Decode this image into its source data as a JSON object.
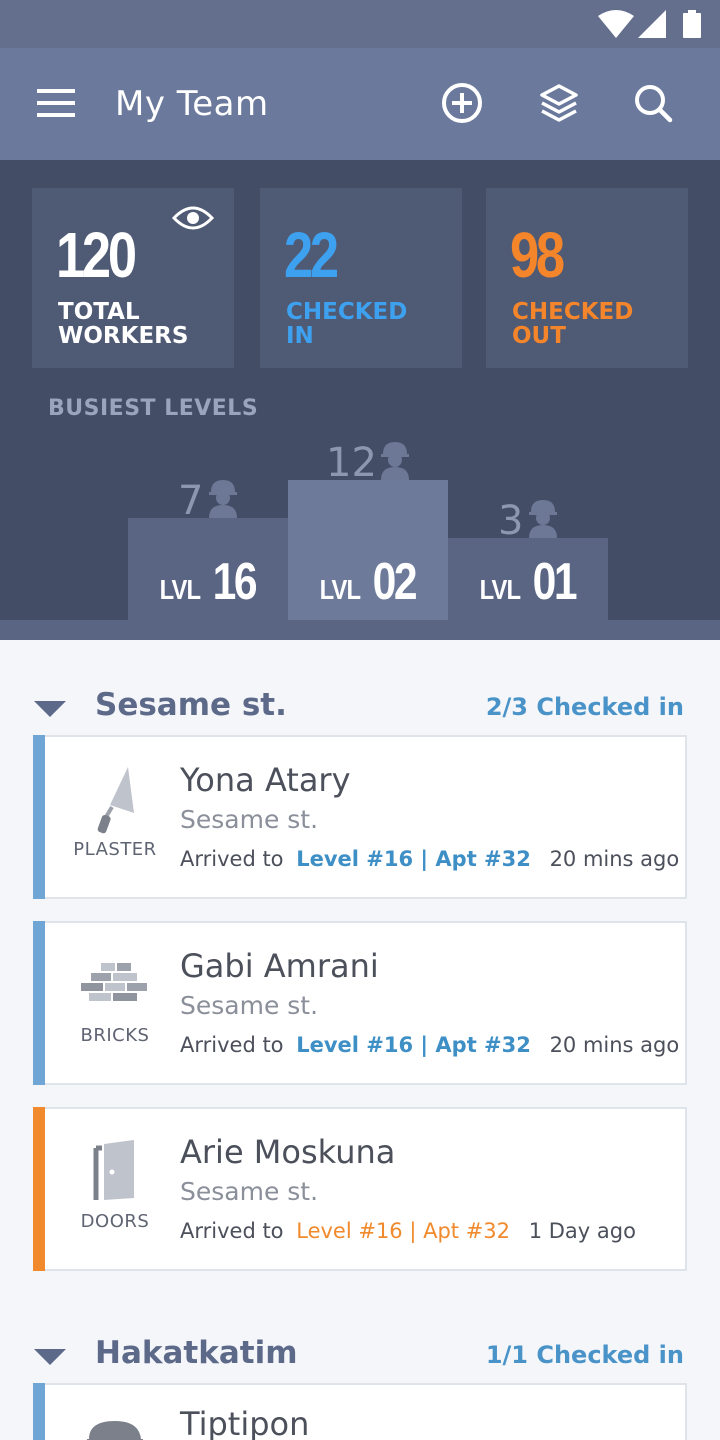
{
  "app": {
    "title": "My Team"
  },
  "stats": {
    "total": {
      "value": "120",
      "label": "TOTAL WORKERS",
      "color": "#ffffff"
    },
    "checked_in": {
      "value": "22",
      "label": "CHECKED IN",
      "color": "#3ea1f0"
    },
    "checked_out": {
      "value": "98",
      "label": "CHECKED OUT",
      "color": "#f5852a"
    }
  },
  "busiest": {
    "title": "BUSIEST LEVELS",
    "levels": [
      {
        "prefix": "LVL",
        "level": "16",
        "count": "7"
      },
      {
        "prefix": "LVL",
        "level": "02",
        "count": "12"
      },
      {
        "prefix": "LVL",
        "level": "01",
        "count": "3"
      }
    ]
  },
  "sections": [
    {
      "name": "Sesame st.",
      "count": "2/3 Checked in",
      "workers": [
        {
          "name": "Yona Atary",
          "site": "Sesame st.",
          "trade": "PLASTER",
          "trade_icon": "trowel-icon",
          "arrived": "Arrived to",
          "location": "Level #16 | Apt #32",
          "ago": "20 mins ago",
          "status_color": "#6fa6d6"
        },
        {
          "name": "Gabi Amrani",
          "site": "Sesame st.",
          "trade": "BRICKS",
          "trade_icon": "bricks-icon",
          "arrived": "Arrived to",
          "location": "Level #16 | Apt #32",
          "ago": "20 mins ago",
          "status_color": "#6fa6d6"
        },
        {
          "name": "Arie Moskuna",
          "site": "Sesame st.",
          "trade": "DOORS",
          "trade_icon": "door-icon",
          "arrived": "Arrived to",
          "location": "Level #16 | Apt #32",
          "ago": "1 Day ago",
          "status_color": "#f08a2c"
        }
      ]
    },
    {
      "name": "Hakatkatim",
      "count": "1/1 Checked in",
      "workers": [
        {
          "name": "Tiptipon",
          "status_color": "#6fa6d6"
        }
      ]
    }
  ]
}
